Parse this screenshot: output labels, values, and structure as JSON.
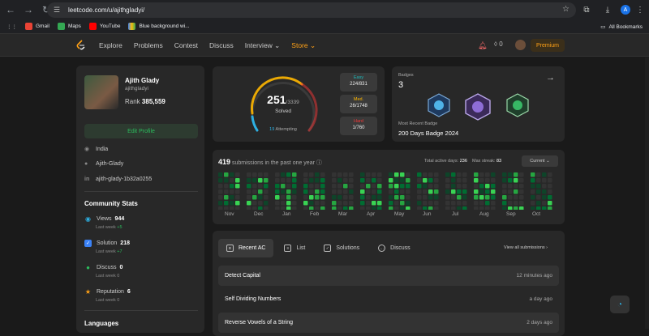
{
  "browser": {
    "url": "leetcode.com/u/ajithgladyi/",
    "profile_initial": "A",
    "bookmarks": [
      {
        "label": "Gmail",
        "color": "#ea4335"
      },
      {
        "label": "Maps",
        "color": "#34a853"
      },
      {
        "label": "YouTube",
        "color": "#ff0000"
      },
      {
        "label": "Blue background wi...",
        "color": "#4285f4"
      }
    ],
    "all_bookmarks": "All Bookmarks"
  },
  "nav": {
    "links": [
      "Explore",
      "Problems",
      "Contest",
      "Discuss",
      "Interview ⌄",
      "Store ⌄"
    ],
    "notif_count": "0",
    "premium": "Premium"
  },
  "profile": {
    "name": "Ajith Glady",
    "username": "ajithgladyi",
    "rank_label": "Rank",
    "rank": "385,559",
    "edit": "Edit Profile",
    "location": "India",
    "github": "Ajith-Glady",
    "linkedin": "ajith-glady-1b32a0255"
  },
  "community": {
    "title": "Community Stats",
    "stats": [
      {
        "label": "Views",
        "value": "944",
        "sub": "Last week",
        "delta": "+5",
        "color": "#2db0e3",
        "icon": "eye-icon"
      },
      {
        "label": "Solution",
        "value": "218",
        "sub": "Last week",
        "delta": "+7",
        "color": "#3b82f6",
        "icon": "check-icon"
      },
      {
        "label": "Discuss",
        "value": "0",
        "sub": "Last week",
        "delta": "0",
        "color": "#2cbb5d",
        "icon": "discuss-icon"
      },
      {
        "label": "Reputation",
        "value": "6",
        "sub": "Last week",
        "delta": "0",
        "color": "#ffa116",
        "icon": "star-icon"
      }
    ],
    "languages": "Languages"
  },
  "solved": {
    "count": "251",
    "total": "/3339",
    "label": "Solved",
    "attempting_count": "19",
    "attempting_label": "Attempting",
    "easy": {
      "label": "Easy",
      "value": "224/831",
      "color": "#1cbaba"
    },
    "medium": {
      "label": "Med.",
      "value": "26/1748",
      "color": "#ffb700"
    },
    "hard": {
      "label": "Hard",
      "value": "1/760",
      "color": "#f63737"
    }
  },
  "badges": {
    "label": "Badges",
    "count": "3",
    "recent_label": "Most Recent Badge",
    "recent_name": "200 Days Badge 2024"
  },
  "heatmap": {
    "count": "419",
    "label": "submissions in the past one year",
    "active_label": "Total active days:",
    "active_days": "236",
    "streak_label": "Max streak:",
    "streak": "83",
    "period": "Current ⌄",
    "months": [
      "Nov",
      "Dec",
      "Jan",
      "Feb",
      "Mar",
      "Apr",
      "May",
      "Jun",
      "Jul",
      "Aug",
      "Sep",
      "Oct"
    ]
  },
  "recent": {
    "tabs": [
      "Recent AC",
      "List",
      "Solutions",
      "Discuss"
    ],
    "view_all": "View all submissions ›",
    "items": [
      {
        "title": "Detect Capital",
        "time": "12 minutes ago"
      },
      {
        "title": "Self Dividing Numbers",
        "time": "a day ago"
      },
      {
        "title": "Reverse Vowels of a String",
        "time": "2 days ago"
      }
    ]
  }
}
